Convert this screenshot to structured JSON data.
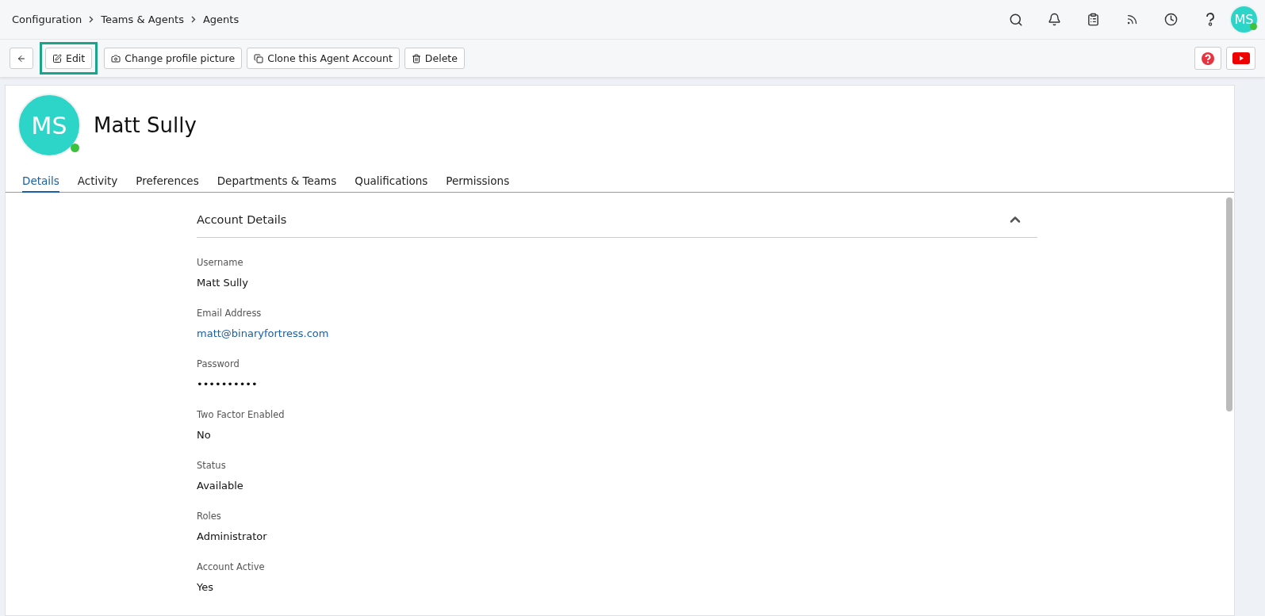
{
  "breadcrumb": [
    "Configuration",
    "Teams & Agents",
    "Agents"
  ],
  "user_avatar": {
    "initials": "MS",
    "online": true
  },
  "toolbar": {
    "buttons": [
      {
        "kind": "back",
        "highlighted": false
      },
      {
        "kind": "edit",
        "label": "Edit",
        "highlighted": true
      },
      {
        "kind": "camera",
        "label": "Change profile picture",
        "highlighted": false
      },
      {
        "kind": "clone",
        "label": "Clone this Agent Account",
        "highlighted": false
      },
      {
        "kind": "delete",
        "label": "Delete",
        "highlighted": false
      }
    ]
  },
  "profile": {
    "initials": "MS",
    "name": "Matt Sully",
    "online": true
  },
  "tabs": [
    {
      "label": "Details",
      "selected": true
    },
    {
      "label": "Activity",
      "selected": false
    },
    {
      "label": "Preferences",
      "selected": false
    },
    {
      "label": "Departments & Teams",
      "selected": false
    },
    {
      "label": "Qualifications",
      "selected": false
    },
    {
      "label": "Permissions",
      "selected": false
    }
  ],
  "section": {
    "title": "Account Details",
    "expanded": true,
    "fields": [
      {
        "label": "Username",
        "value": "Matt Sully",
        "kind": "text"
      },
      {
        "label": "Email Address",
        "value": "matt@binaryfortress.com",
        "kind": "link"
      },
      {
        "label": "Password",
        "value": "••••••••••",
        "kind": "text"
      },
      {
        "label": "Two Factor Enabled",
        "value": "No",
        "kind": "text"
      },
      {
        "label": "Status",
        "value": "Available",
        "kind": "text"
      },
      {
        "label": "Roles",
        "value": "Administrator",
        "kind": "text"
      },
      {
        "label": "Account Active",
        "value": "Yes",
        "kind": "text"
      }
    ]
  }
}
